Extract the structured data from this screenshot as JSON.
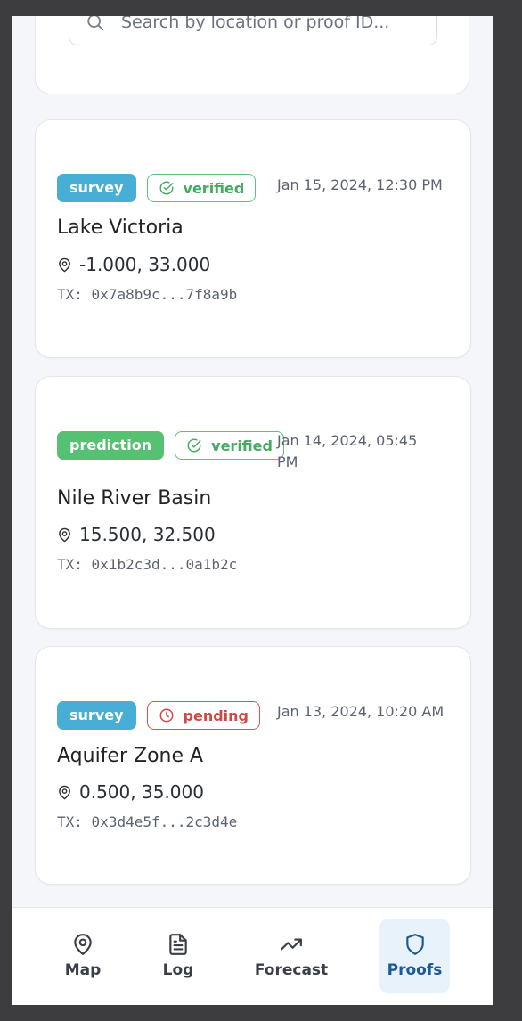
{
  "search": {
    "placeholder": "Search by location or proof ID..."
  },
  "proofs": [
    {
      "type": "survey",
      "status": "verified",
      "date": "Jan 15, 2024, 12:30 PM",
      "title": "Lake Victoria",
      "coords": "-1.000, 33.000",
      "tx_prefix": "TX:",
      "tx_start": "0x7a8b9c",
      "tx_ellipsis": "...",
      "tx_end": "7f8a9b"
    },
    {
      "type": "prediction",
      "status": "verified",
      "date": "Jan 14, 2024, 05:45 PM",
      "title": "Nile River Basin",
      "coords": "15.500, 32.500",
      "tx_prefix": "TX:",
      "tx_start": "0x1b2c3d",
      "tx_ellipsis": "...",
      "tx_end": "0a1b2c"
    },
    {
      "type": "survey",
      "status": "pending",
      "date": "Jan 13, 2024, 10:20 AM",
      "title": "Aquifer Zone A",
      "coords": "0.500, 35.000",
      "tx_prefix": "TX:",
      "tx_start": "0x3d4e5f",
      "tx_ellipsis": "...",
      "tx_end": "2c3d4e"
    }
  ],
  "nav": {
    "items": [
      {
        "label": "Map",
        "icon": "map-pin-icon"
      },
      {
        "label": "Log",
        "icon": "document-icon"
      },
      {
        "label": "Forecast",
        "icon": "trending-up-icon"
      },
      {
        "label": "Proofs",
        "icon": "shield-icon",
        "active": true
      }
    ]
  },
  "colors": {
    "survey": "#49aed6",
    "prediction": "#56c172",
    "verified": "#45ab63",
    "pending": "#cf4a45",
    "active_nav": "#1d5a94"
  }
}
